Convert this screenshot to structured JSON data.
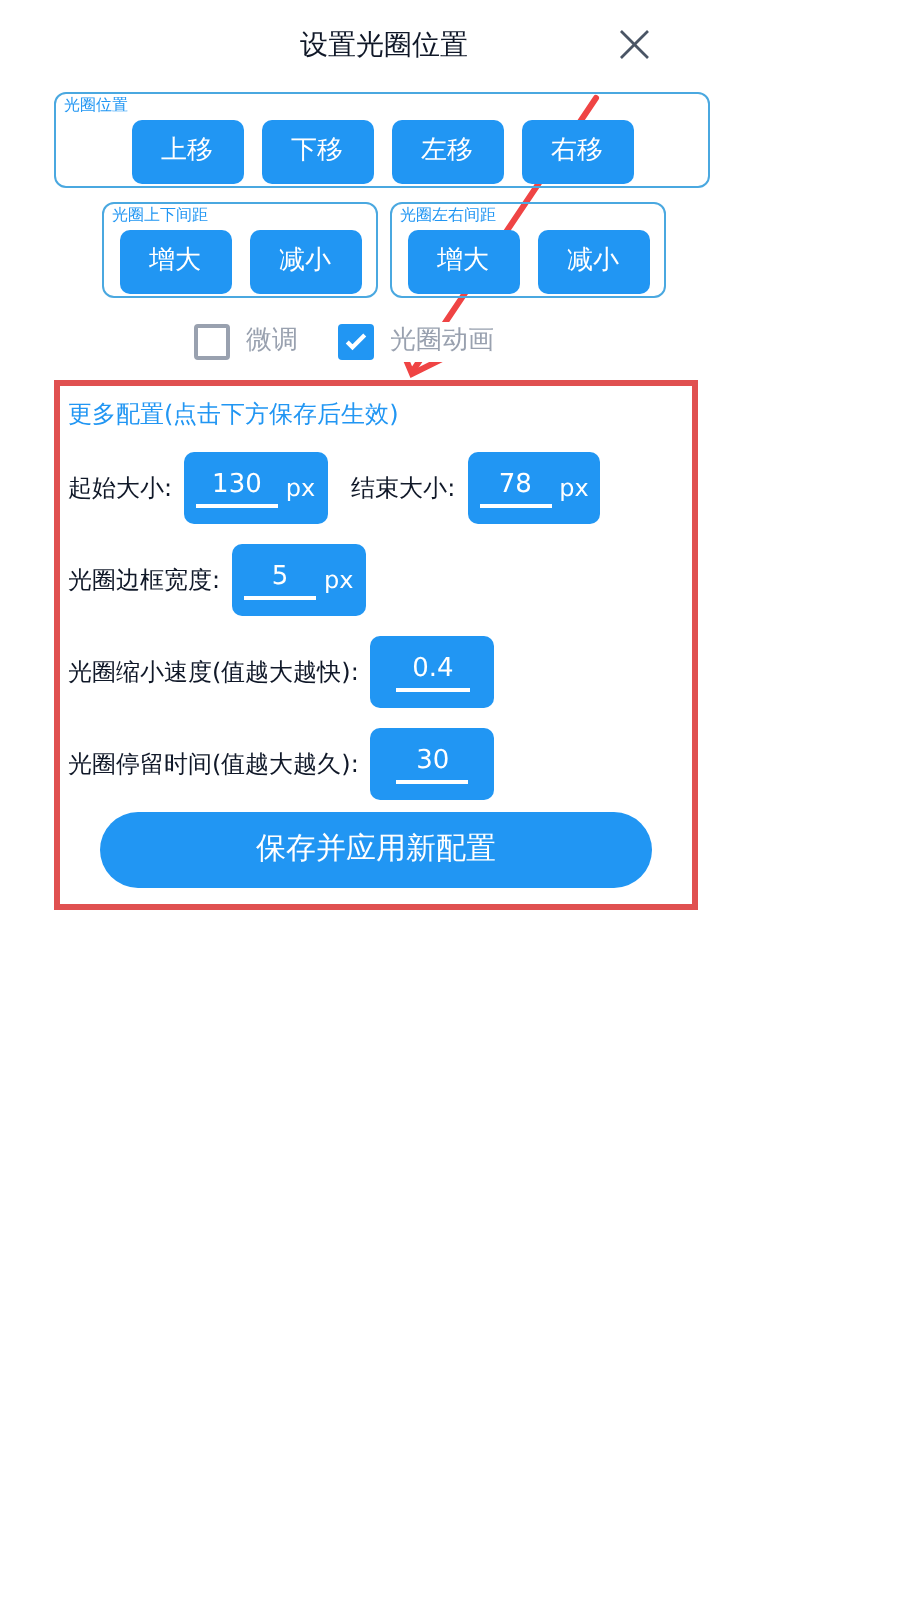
{
  "title": "设置光圈位置",
  "close": "×",
  "position_group": {
    "label": "光圈位置",
    "buttons": [
      "上移",
      "下移",
      "左移",
      "右移"
    ]
  },
  "spacing_groups": [
    {
      "label": "光圈上下间距",
      "buttons": [
        "增大",
        "减小"
      ]
    },
    {
      "label": "光圈左右间距",
      "buttons": [
        "增大",
        "减小"
      ]
    }
  ],
  "options": [
    {
      "label": "微调",
      "checked": false
    },
    {
      "label": "光圈动画",
      "checked": true
    }
  ],
  "config": {
    "heading": "更多配置(点击下方保存后生效)",
    "rows": [
      {
        "fields": [
          {
            "label": "起始大小:",
            "value": "130",
            "unit": "px"
          },
          {
            "label": "结束大小:",
            "value": "78",
            "unit": "px"
          }
        ]
      },
      {
        "fields": [
          {
            "label": "光圈边框宽度:",
            "value": "5",
            "unit": "px"
          }
        ]
      },
      {
        "fields": [
          {
            "label": "光圈缩小速度(值越大越快):",
            "value": "0.4"
          }
        ]
      },
      {
        "fields": [
          {
            "label": "光圈停留时间(值越大越久):",
            "value": "30"
          }
        ]
      }
    ],
    "save": "保存并应用新配置"
  }
}
